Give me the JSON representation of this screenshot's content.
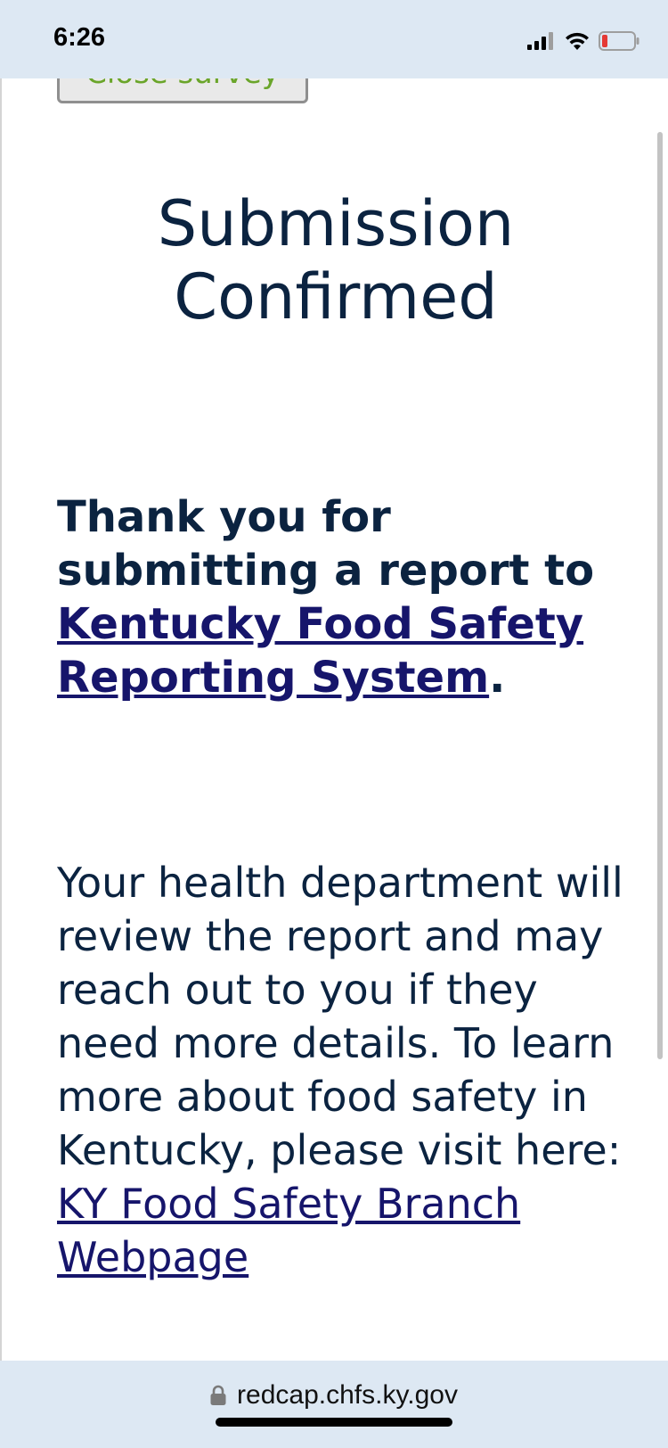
{
  "status_bar": {
    "time": "6:26",
    "signal_icon": "cellular-signal-icon",
    "wifi_icon": "wifi-icon",
    "battery_icon": "battery-low-icon",
    "battery_color": "#e53935"
  },
  "page": {
    "close_button_label": "Close survey",
    "title_line1": "Submission",
    "title_line2": "Confirmed",
    "thanks_prefix": "Thank you for submitting a report to",
    "thanks_link": "Kentucky Food Safety Reporting System",
    "thanks_suffix": ".",
    "body_text": "Your health department will review the report and may reach out to you if they need more details. To learn more about food safety in Kentucky, please visit here:",
    "body_link": "KY Food Safety Branch Webpage"
  },
  "browser": {
    "lock_icon": "lock-icon",
    "url": "redcap.chfs.ky.gov"
  },
  "colors": {
    "heading": "#0b2340",
    "link": "#16156b",
    "close_text": "#6aa52a",
    "chrome_bg": "#dde8f3"
  }
}
